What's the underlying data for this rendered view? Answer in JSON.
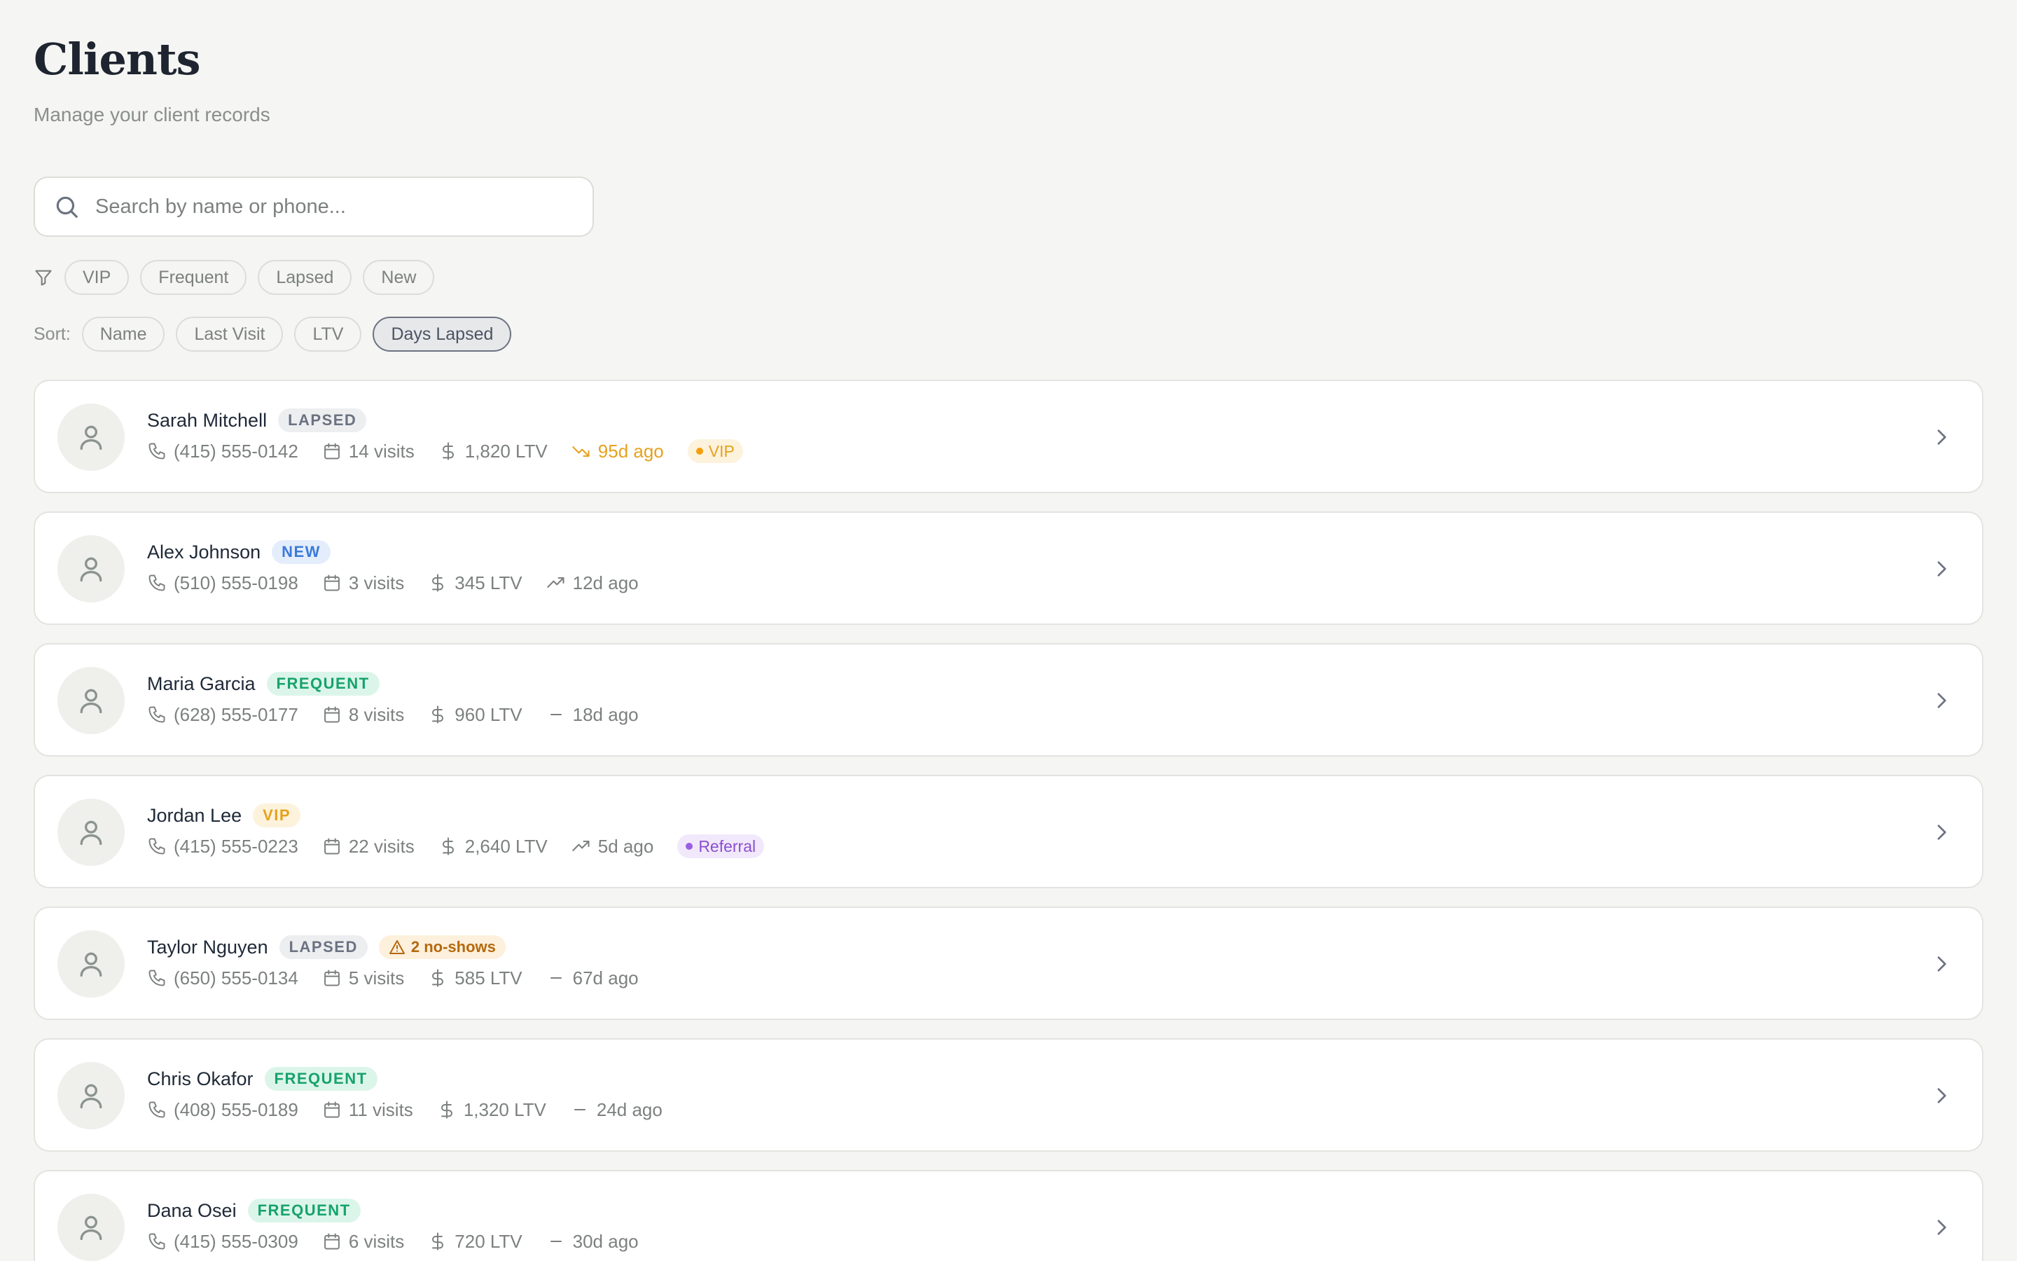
{
  "header": {
    "title": "Clients",
    "subtitle": "Manage your client records"
  },
  "search": {
    "placeholder": "Search by name or phone...",
    "value": ""
  },
  "filters": {
    "chips": [
      "VIP",
      "Frequent",
      "Lapsed",
      "New"
    ]
  },
  "sort": {
    "label": "Sort:",
    "options": [
      "Name",
      "Last Visit",
      "LTV",
      "Days Lapsed"
    ],
    "active": "Days Lapsed"
  },
  "colors": {
    "lapsed": "#6b7280",
    "new": "#3b7ad9",
    "frequent": "#16a36b",
    "vip": "#e5a21f",
    "referral": "#8b4fcf"
  },
  "clients": [
    {
      "name": "Sarah Mitchell",
      "status": "LAPSED",
      "status_type": "lapsed",
      "phone": "(415) 555-0142",
      "visits": "14 visits",
      "ltv": "1,820 LTV",
      "last_visit": "95d ago",
      "trend_icon": "trending-down-icon",
      "trend_alert": true,
      "tag": "VIP",
      "tag_type": "vip"
    },
    {
      "name": "Alex Johnson",
      "status": "NEW",
      "status_type": "new",
      "phone": "(510) 555-0198",
      "visits": "3 visits",
      "ltv": "345 LTV",
      "last_visit": "12d ago",
      "trend_icon": "trending-up-icon"
    },
    {
      "name": "Maria Garcia",
      "status": "FREQUENT",
      "status_type": "frequent",
      "phone": "(628) 555-0177",
      "visits": "8 visits",
      "ltv": "960 LTV",
      "last_visit": "18d ago",
      "trend_icon": "minus-icon"
    },
    {
      "name": "Jordan Lee",
      "status": "VIP",
      "status_type": "vip",
      "phone": "(415) 555-0223",
      "visits": "22 visits",
      "ltv": "2,640 LTV",
      "last_visit": "5d ago",
      "trend_icon": "trending-up-icon",
      "tag": "Referral",
      "tag_type": "referral"
    },
    {
      "name": "Taylor Nguyen",
      "status": "LAPSED",
      "status_type": "lapsed",
      "warning": "2 no-shows",
      "phone": "(650) 555-0134",
      "visits": "5 visits",
      "ltv": "585 LTV",
      "last_visit": "67d ago",
      "trend_icon": "minus-icon"
    },
    {
      "name": "Chris Okafor",
      "status": "FREQUENT",
      "status_type": "frequent",
      "phone": "(408) 555-0189",
      "visits": "11 visits",
      "ltv": "1,320 LTV",
      "last_visit": "24d ago",
      "trend_icon": "minus-icon"
    },
    {
      "name": "Dana Osei",
      "status": "FREQUENT",
      "status_type": "frequent",
      "phone": "(415) 555-0309",
      "visits": "6 visits",
      "ltv": "720 LTV",
      "last_visit": "30d ago",
      "trend_icon": "minus-icon"
    }
  ]
}
